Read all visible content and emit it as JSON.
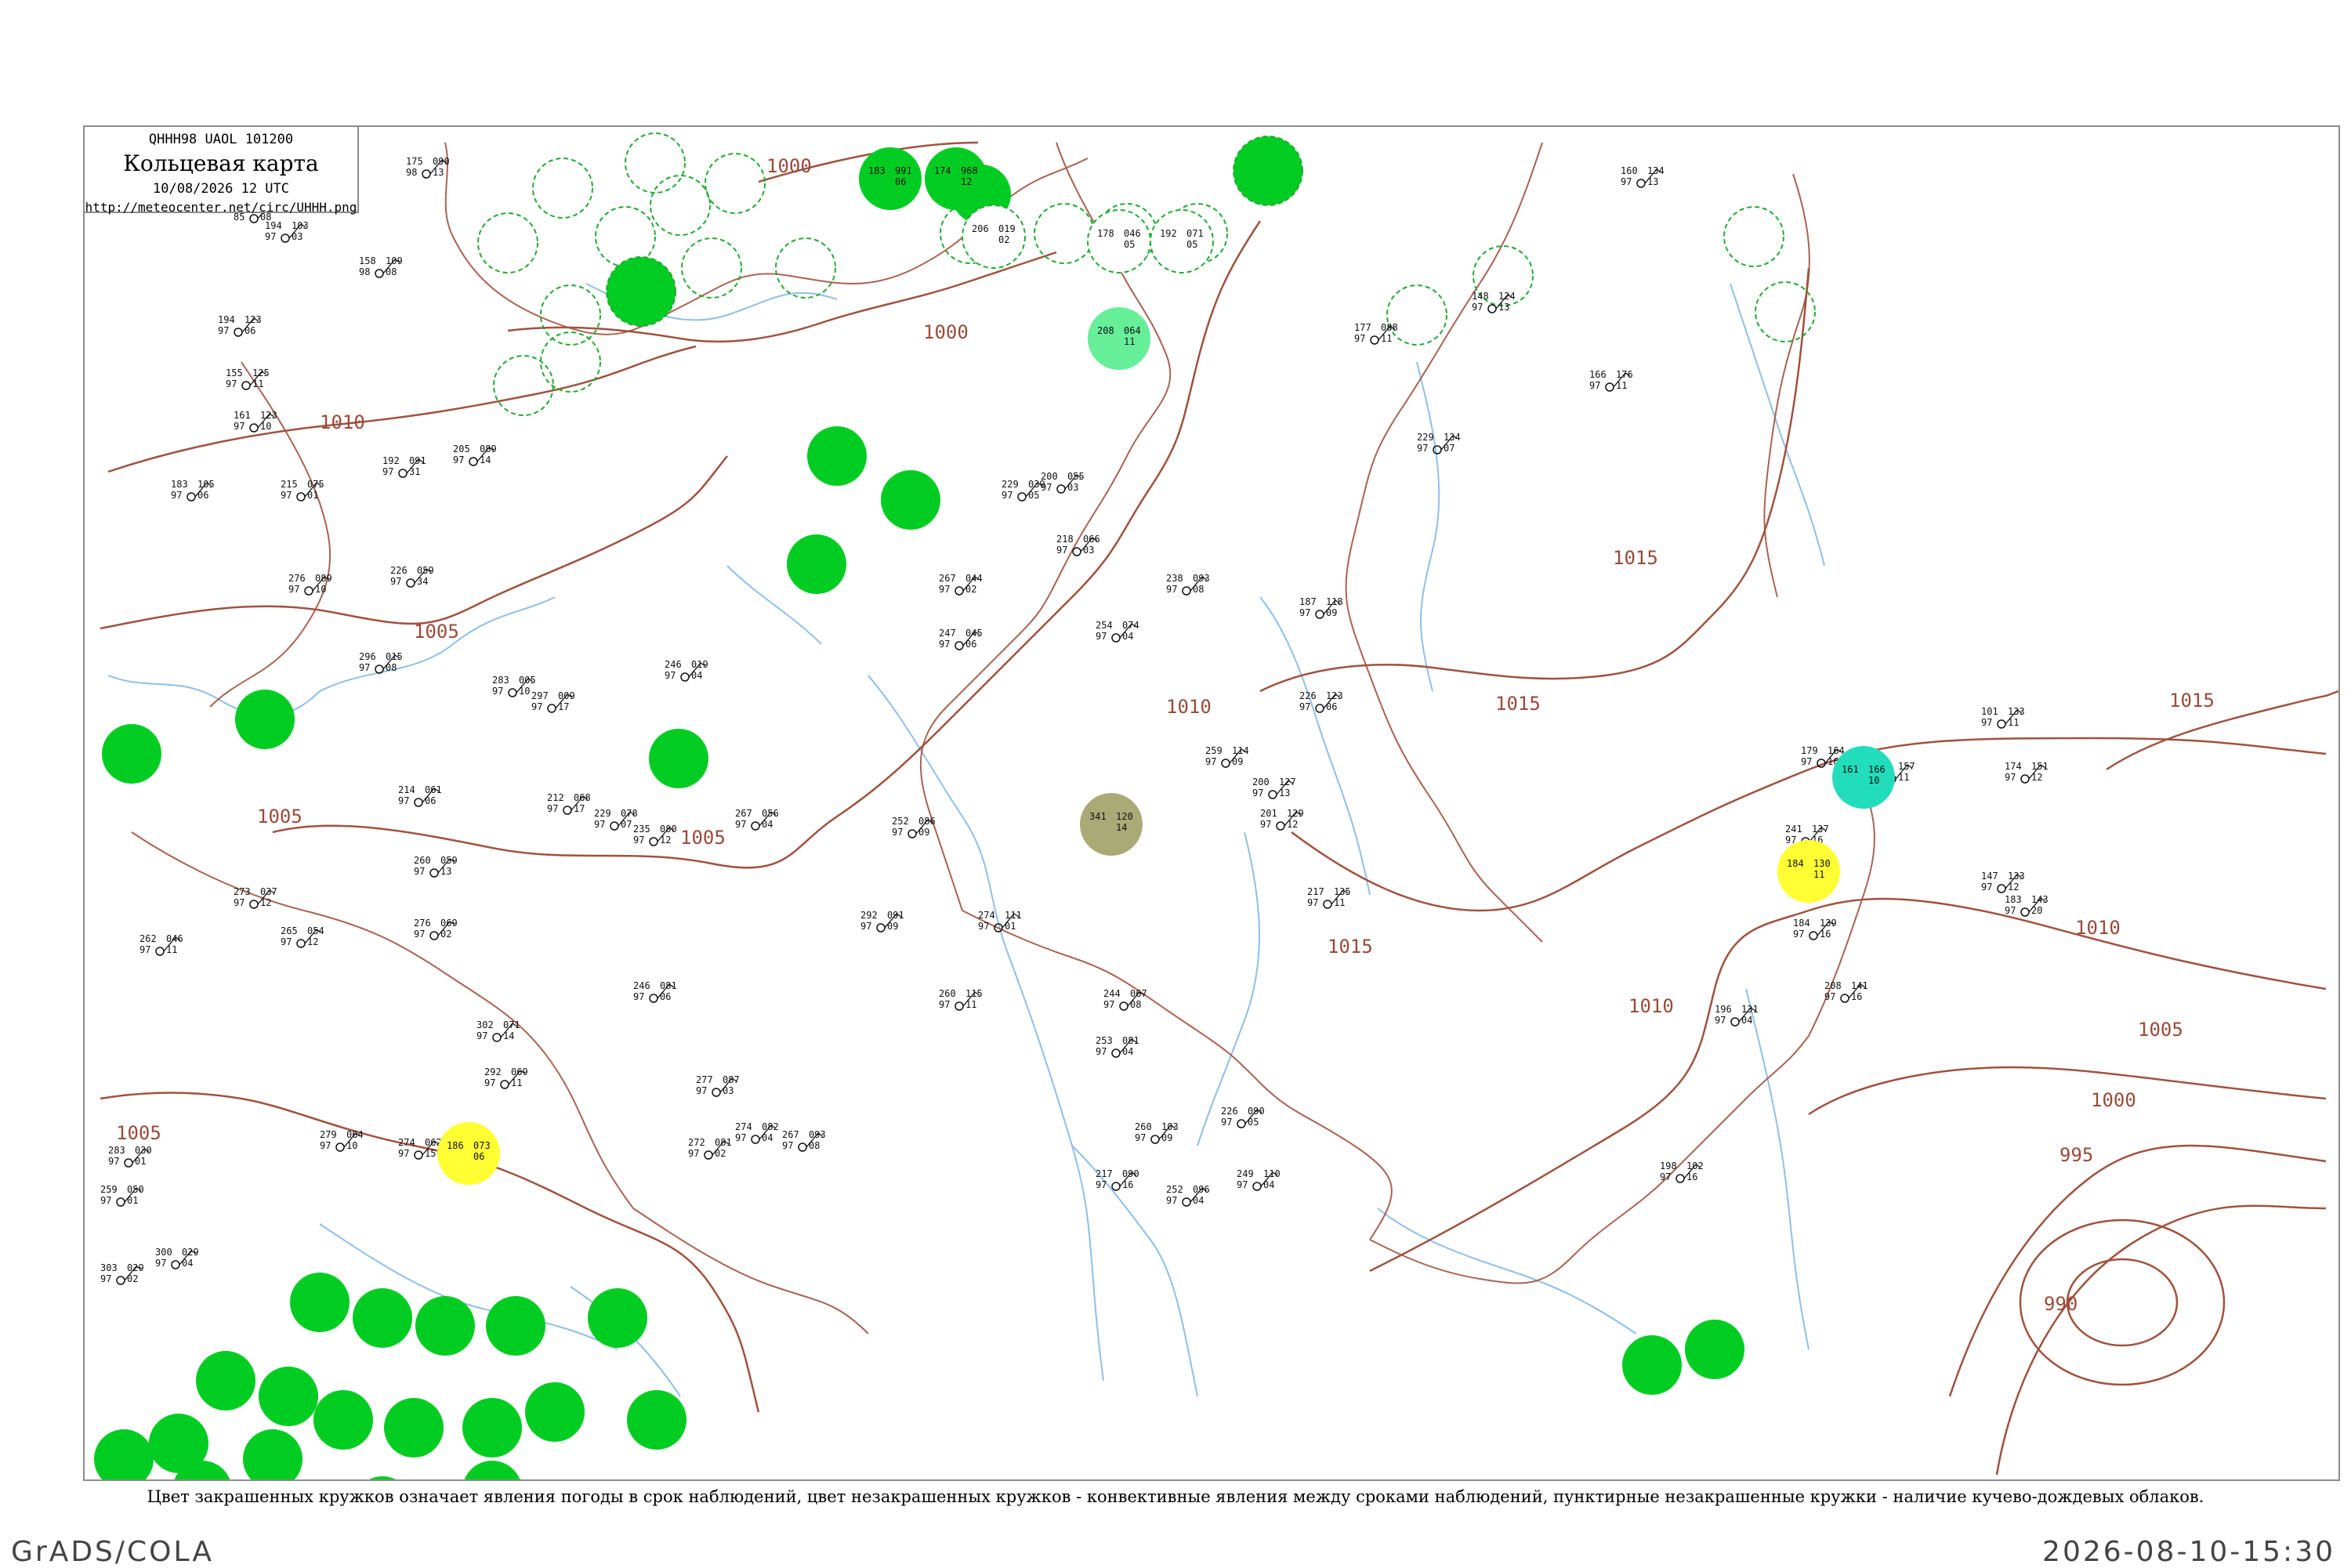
{
  "title": {
    "code": "QHHH98  UAOL  101200",
    "name": "Кольцевая карта",
    "datetime": "10/08/2026 12 UTC",
    "url": "http://meteocenter.net/circ/UHHH.png"
  },
  "caption": "Цвет закрашенных кружков означает явления погоды в срок наблюдений, цвет незакрашенных кружков - конвективные явления между сроками наблюдений, пунктирные незакрашенные кружки - наличие кучево-дождевых облаков.",
  "footer": {
    "left": "GrADS/COLA",
    "right": "2026-08-10-15:30"
  },
  "colors": {
    "isobar": "#a0523f",
    "river": "#7bb4e6",
    "border": "#8c8c8c",
    "rain": "#00cc22",
    "cb_ring": "#22aa33",
    "teal": "#22ddbb",
    "yellow": "#ffff33",
    "olive": "#aaaa77",
    "light_green": "#66ee99"
  },
  "isobar_labels": [
    "1000",
    "1000",
    "1010",
    "1005",
    "1005",
    "1005",
    "1005",
    "1010",
    "1015",
    "1015",
    "1015",
    "1010",
    "1010",
    "1005",
    "1000",
    "995",
    "990",
    "1015"
  ],
  "stations": [
    {
      "t": "175",
      "d": "98",
      "p": "090",
      "c": "13"
    },
    {
      "t": "153",
      "d": "85",
      "p": "107",
      "c": "08"
    },
    {
      "t": "194",
      "d": "97",
      "p": "103",
      "c": "03"
    },
    {
      "t": "158",
      "d": "98",
      "p": "109",
      "c": "08"
    },
    {
      "t": "194",
      "d": "97",
      "p": "123",
      "c": "06"
    },
    {
      "t": "155",
      "d": "97",
      "p": "125",
      "c": "11"
    },
    {
      "t": "161",
      "d": "97",
      "p": "123",
      "c": "10"
    },
    {
      "t": "183",
      "d": "97",
      "p": "105",
      "c": "06"
    },
    {
      "t": "215",
      "d": "97",
      "p": "075",
      "c": "01"
    },
    {
      "t": "192",
      "d": "97",
      "p": "091",
      "c": "31"
    },
    {
      "t": "205",
      "d": "97",
      "p": "089",
      "c": "14"
    },
    {
      "t": "276",
      "d": "97",
      "p": "089",
      "c": "10"
    },
    {
      "t": "226",
      "d": "97",
      "p": "059",
      "c": "34"
    },
    {
      "t": "296",
      "d": "97",
      "p": "015",
      "c": "08"
    },
    {
      "t": "283",
      "d": "97",
      "p": "005",
      "c": "10"
    },
    {
      "t": "297",
      "d": "97",
      "p": "009",
      "c": "17"
    },
    {
      "t": "246",
      "d": "97",
      "p": "019",
      "c": "04"
    },
    {
      "t": "214",
      "d": "97",
      "p": "061",
      "c": "06"
    },
    {
      "t": "212",
      "d": "97",
      "p": "068",
      "c": "17"
    },
    {
      "t": "229",
      "d": "97",
      "p": "078",
      "c": "07"
    },
    {
      "t": "235",
      "d": "97",
      "p": "080",
      "c": "12"
    },
    {
      "t": "260",
      "d": "97",
      "p": "059",
      "c": "13"
    },
    {
      "t": "273",
      "d": "97",
      "p": "037",
      "c": "12"
    },
    {
      "t": "262",
      "d": "97",
      "p": "046",
      "c": "11"
    },
    {
      "t": "265",
      "d": "97",
      "p": "054",
      "c": "12"
    },
    {
      "t": "276",
      "d": "97",
      "p": "069",
      "c": "02"
    },
    {
      "t": "302",
      "d": "97",
      "p": "071",
      "c": "14"
    },
    {
      "t": "292",
      "d": "97",
      "p": "069",
      "c": "11"
    },
    {
      "t": "279",
      "d": "97",
      "p": "064",
      "c": "10"
    },
    {
      "t": "274",
      "d": "97",
      "p": "062",
      "c": "15"
    },
    {
      "t": "283",
      "d": "97",
      "p": "030",
      "c": "01"
    },
    {
      "t": "259",
      "d": "97",
      "p": "050",
      "c": "01"
    },
    {
      "t": "303",
      "d": "97",
      "p": "029",
      "c": "02"
    },
    {
      "t": "300",
      "d": "97",
      "p": "029",
      "c": "04"
    },
    {
      "t": "277",
      "d": "97",
      "p": "087",
      "c": "03"
    },
    {
      "t": "272",
      "d": "97",
      "p": "081",
      "c": "02"
    },
    {
      "t": "267",
      "d": "97",
      "p": "093",
      "c": "08"
    },
    {
      "t": "274",
      "d": "97",
      "p": "082",
      "c": "04"
    },
    {
      "t": "246",
      "d": "97",
      "p": "081",
      "c": "06"
    },
    {
      "t": "267",
      "d": "97",
      "p": "056",
      "c": "04"
    },
    {
      "t": "252",
      "d": "97",
      "p": "086",
      "c": "09"
    },
    {
      "t": "292",
      "d": "97",
      "p": "091",
      "c": "09"
    },
    {
      "t": "274",
      "d": "97",
      "p": "111",
      "c": "01"
    },
    {
      "t": "260",
      "d": "97",
      "p": "115",
      "c": "11"
    },
    {
      "t": "267",
      "d": "97",
      "p": "044",
      "c": "02"
    },
    {
      "t": "247",
      "d": "97",
      "p": "045",
      "c": "06"
    },
    {
      "t": "229",
      "d": "97",
      "p": "039",
      "c": "05"
    },
    {
      "t": "200",
      "d": "97",
      "p": "055",
      "c": "03"
    },
    {
      "t": "218",
      "d": "97",
      "p": "066",
      "c": "03"
    },
    {
      "t": "254",
      "d": "97",
      "p": "074",
      "c": "04"
    },
    {
      "t": "238",
      "d": "97",
      "p": "093",
      "c": "08"
    },
    {
      "t": "187",
      "d": "97",
      "p": "118",
      "c": "09"
    },
    {
      "t": "226",
      "d": "97",
      "p": "123",
      "c": "06"
    },
    {
      "t": "259",
      "d": "97",
      "p": "114",
      "c": "09"
    },
    {
      "t": "200",
      "d": "97",
      "p": "127",
      "c": "13"
    },
    {
      "t": "201",
      "d": "97",
      "p": "129",
      "c": "12"
    },
    {
      "t": "217",
      "d": "97",
      "p": "135",
      "c": "11"
    },
    {
      "t": "229",
      "d": "97",
      "p": "134",
      "c": "07"
    },
    {
      "t": "249",
      "d": "97",
      "p": "110",
      "c": "04"
    },
    {
      "t": "260",
      "d": "97",
      "p": "103",
      "c": "09"
    },
    {
      "t": "252",
      "d": "97",
      "p": "096",
      "c": "04"
    },
    {
      "t": "244",
      "d": "97",
      "p": "067",
      "c": "08"
    },
    {
      "t": "253",
      "d": "97",
      "p": "081",
      "c": "04"
    },
    {
      "t": "226",
      "d": "97",
      "p": "090",
      "c": "05"
    },
    {
      "t": "217",
      "d": "97",
      "p": "090",
      "c": "16"
    },
    {
      "t": "198",
      "d": "97",
      "p": "102",
      "c": "16"
    },
    {
      "t": "196",
      "d": "97",
      "p": "131",
      "c": "04"
    },
    {
      "t": "208",
      "d": "97",
      "p": "141",
      "c": "16"
    },
    {
      "t": "179",
      "d": "97",
      "p": "164",
      "c": "16"
    },
    {
      "t": "241",
      "d": "97",
      "p": "137",
      "c": "16"
    },
    {
      "t": "167",
      "d": "97",
      "p": "157",
      "c": "11"
    },
    {
      "t": "184",
      "d": "97",
      "p": "139",
      "c": "16"
    },
    {
      "t": "101",
      "d": "97",
      "p": "133",
      "c": "11"
    },
    {
      "t": "160",
      "d": "97",
      "p": "134",
      "c": "13"
    },
    {
      "t": "148",
      "d": "97",
      "p": "124",
      "c": "13"
    },
    {
      "t": "177",
      "d": "97",
      "p": "088",
      "c": "11"
    },
    {
      "t": "166",
      "d": "97",
      "p": "176",
      "c": "11"
    },
    {
      "t": "147",
      "d": "97",
      "p": "133",
      "c": "12"
    },
    {
      "t": "183",
      "d": "97",
      "p": "143",
      "c": "20"
    },
    {
      "t": "174",
      "d": "97",
      "p": "151",
      "c": "12"
    }
  ],
  "filled_markers": [
    {
      "t": "183",
      "p": "991",
      "c": "06"
    },
    {
      "t": "174",
      "p": "968",
      "c": "12"
    },
    {
      "t": "206",
      "p": "019",
      "c": "02"
    },
    {
      "t": "178",
      "p": "046",
      "c": "05"
    },
    {
      "t": "192",
      "p": "071",
      "c": "05"
    },
    {
      "t": "208",
      "p": "064",
      "c": "11"
    },
    {
      "t": "341",
      "p": "120",
      "c": "14"
    },
    {
      "t": "186",
      "p": "073",
      "c": "06"
    },
    {
      "t": "184",
      "p": "130",
      "c": "11"
    },
    {
      "t": "161",
      "p": "166",
      "c": "10"
    }
  ]
}
